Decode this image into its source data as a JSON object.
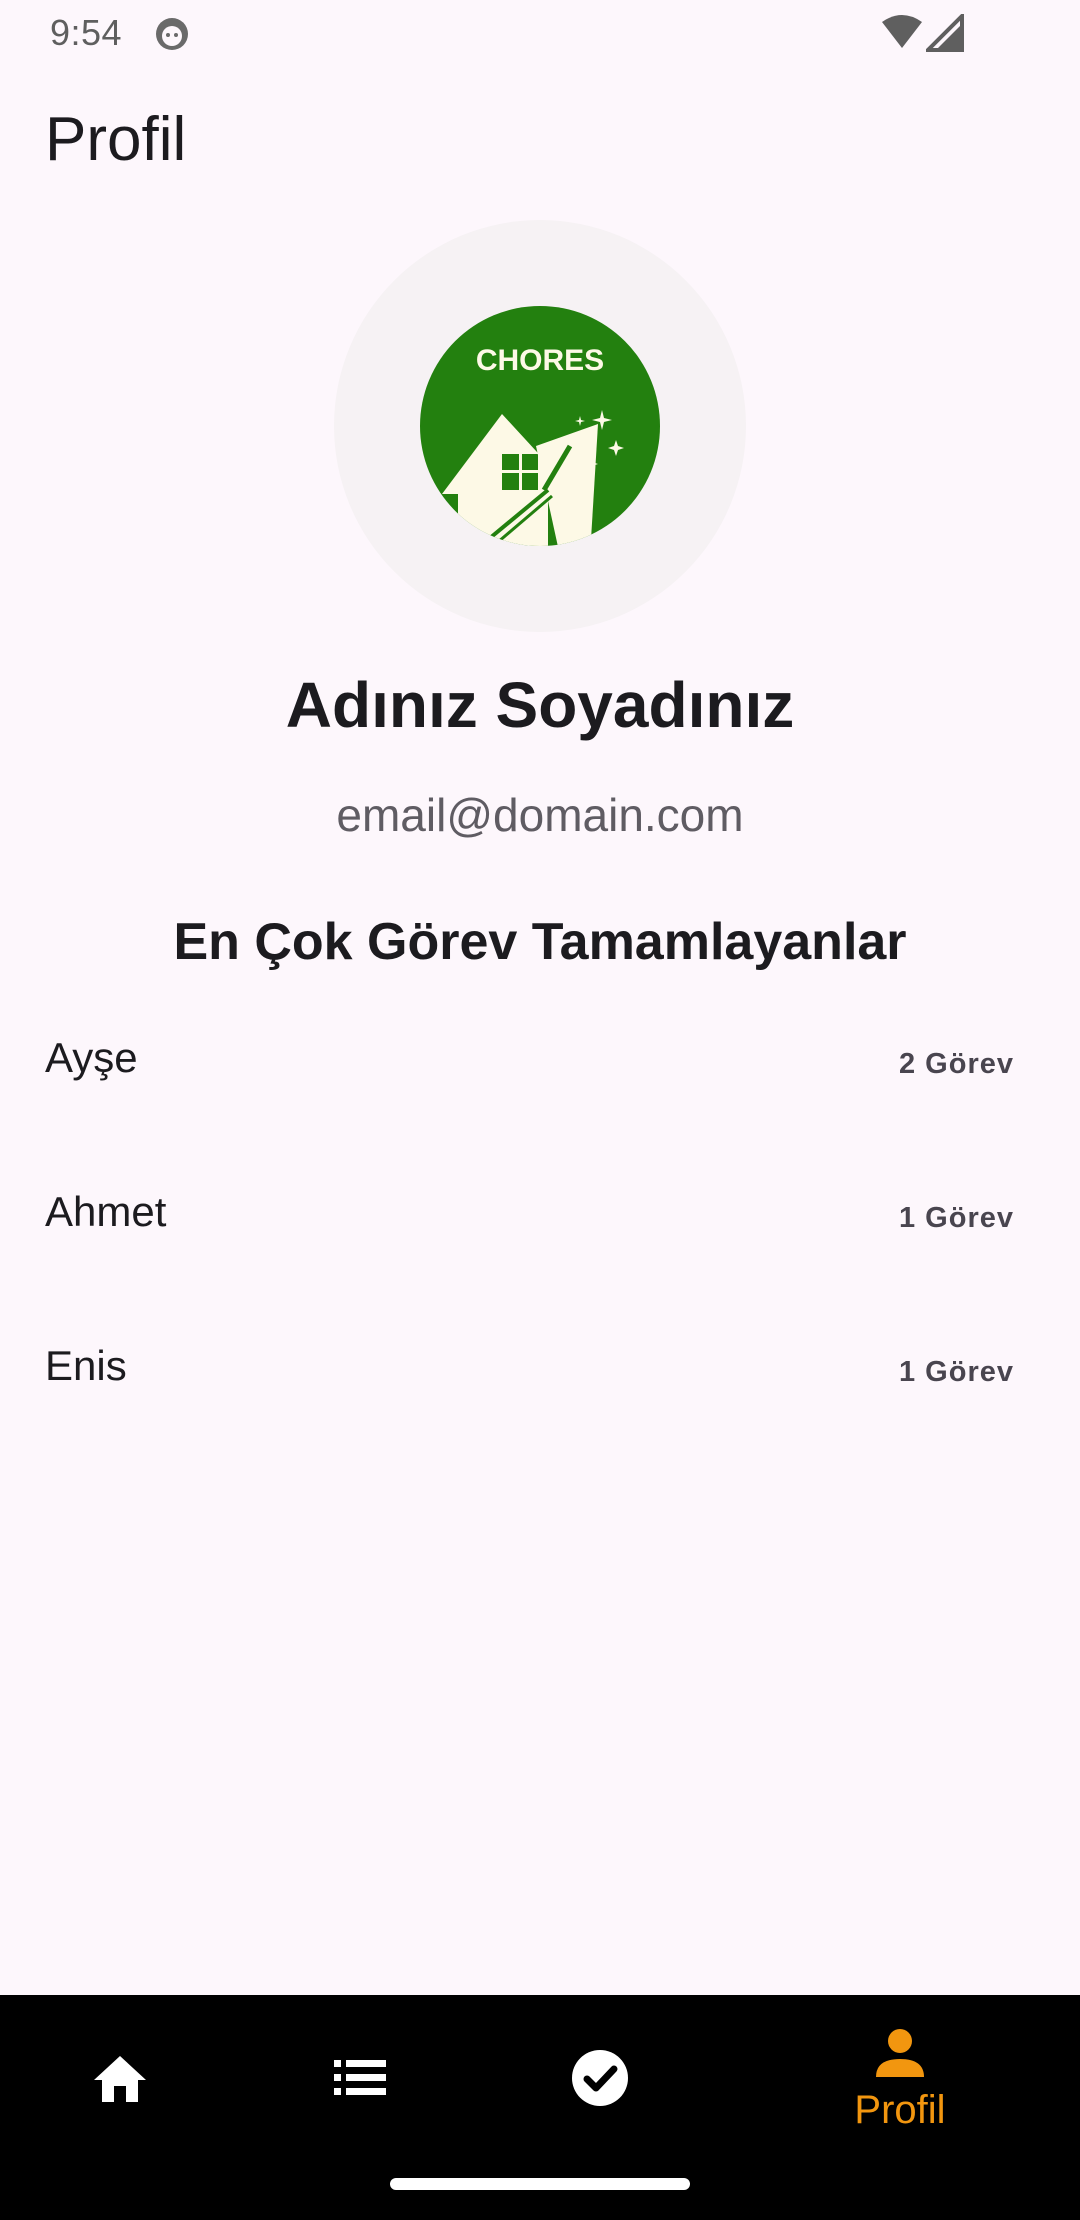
{
  "status_bar": {
    "time": "9:54"
  },
  "header": {
    "title": "Profil"
  },
  "logo": {
    "text": "CHORES",
    "bg_color": "#23800f",
    "house_color": "#fdf9e6"
  },
  "profile": {
    "name": "Adınız Soyadınız",
    "email": "email@domain.com"
  },
  "leaderboard": {
    "title": "En Çok Görev Tamamlayanlar",
    "rows": [
      {
        "name": "Ayşe",
        "count": "2 Görev"
      },
      {
        "name": "Ahmet",
        "count": "1 Görev"
      },
      {
        "name": "Enis",
        "count": "1 Görev"
      }
    ]
  },
  "bottom_nav": {
    "items": [
      {
        "icon": "home-icon",
        "label": ""
      },
      {
        "icon": "list-icon",
        "label": ""
      },
      {
        "icon": "check-circle-icon",
        "label": ""
      },
      {
        "icon": "person-icon",
        "label": "Profil",
        "active": true
      }
    ],
    "active_color": "#f2960f"
  }
}
